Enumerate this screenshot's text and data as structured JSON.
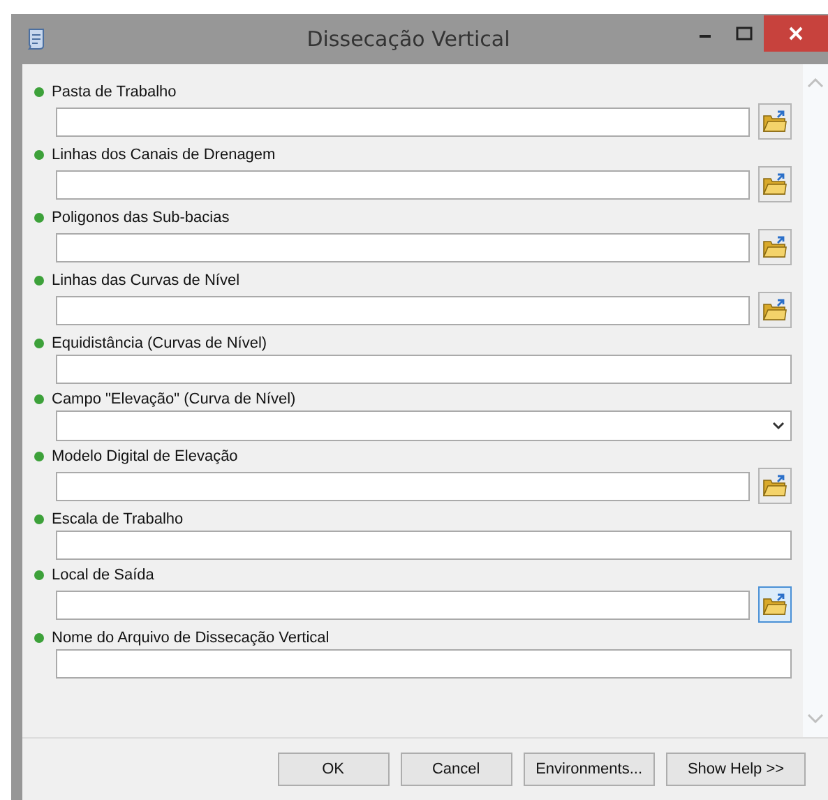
{
  "window": {
    "title": "Dissecação Vertical"
  },
  "fields": [
    {
      "label": "Pasta de Trabalho",
      "kind": "path",
      "focused": false
    },
    {
      "label": "Linhas dos Canais de Drenagem",
      "kind": "path",
      "focused": false
    },
    {
      "label": "Poligonos das Sub-bacias",
      "kind": "path",
      "focused": false
    },
    {
      "label": "Linhas das Curvas de Nível",
      "kind": "path",
      "focused": false
    },
    {
      "label": "Equidistância (Curvas de Nível)",
      "kind": "text"
    },
    {
      "label": "Campo \"Elevação\" (Curva de Nível)",
      "kind": "dropdown"
    },
    {
      "label": "Modelo Digital de Elevação",
      "kind": "path",
      "focused": false
    },
    {
      "label": "Escala de Trabalho",
      "kind": "text"
    },
    {
      "label": "Local de Saída",
      "kind": "path",
      "focused": true
    },
    {
      "label": "Nome do Arquivo de Dissecação Vertical",
      "kind": "text"
    }
  ],
  "buttons": [
    "OK",
    "Cancel",
    "Environments...",
    "Show Help >>"
  ]
}
